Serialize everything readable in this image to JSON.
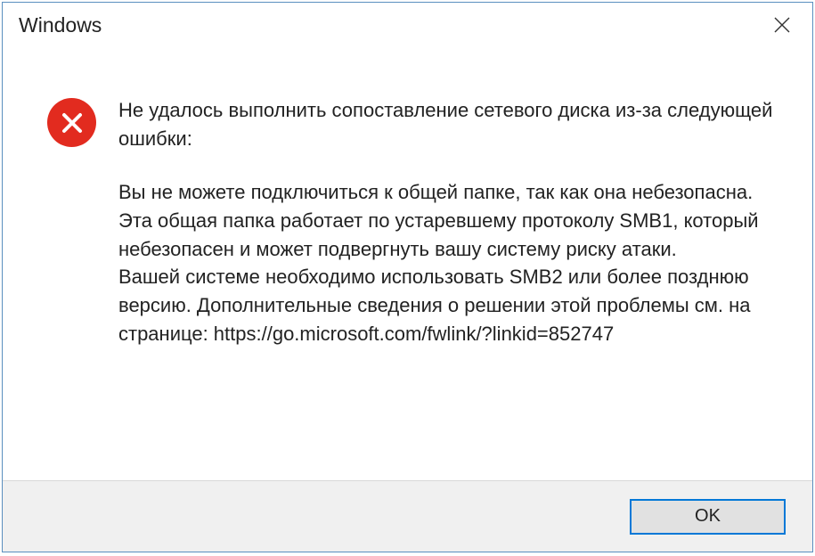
{
  "titlebar": {
    "title": "Windows"
  },
  "message": {
    "header": "Не удалось выполнить сопоставление сетевого диска из-за следующей ошибки:",
    "body": "Вы не можете подключиться к общей папке, так как она небезопасна. Эта общая папка работает по устаревшему протоколу SMB1, который небезопасен и может подвергнуть вашу систему риску атаки.\nВашей системе необходимо использовать SMB2 или более позднюю версию. Дополнительные сведения о решении этой проблемы см. на странице: https://go.microsoft.com/fwlink/?linkid=852747"
  },
  "buttons": {
    "ok_label": "OK"
  }
}
